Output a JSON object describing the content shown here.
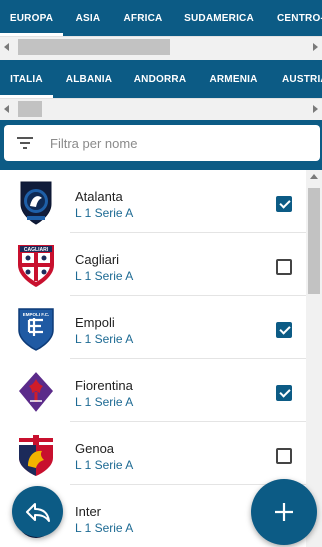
{
  "continent_tabs": [
    {
      "label": "EUROPA",
      "active": true
    },
    {
      "label": "ASIA"
    },
    {
      "label": "AFRICA"
    },
    {
      "label": "SUDAMERICA"
    },
    {
      "label": "CENTRO-NORD AMERICA"
    }
  ],
  "country_tabs": [
    {
      "label": "ITALIA",
      "active": true
    },
    {
      "label": "ALBANIA"
    },
    {
      "label": "ANDORRA"
    },
    {
      "label": "ARMENIA"
    },
    {
      "label": "AUSTRIA"
    }
  ],
  "filter": {
    "placeholder": "Filtra per nome",
    "value": ""
  },
  "teams": [
    {
      "name": "Atalanta",
      "league": "L 1 Serie A",
      "checked": true,
      "crest_icon": "atalanta-crest-icon"
    },
    {
      "name": "Cagliari",
      "league": "L 1 Serie A",
      "checked": false,
      "crest_icon": "cagliari-crest-icon"
    },
    {
      "name": "Empoli",
      "league": "L 1 Serie A",
      "checked": true,
      "crest_icon": "empoli-crest-icon"
    },
    {
      "name": "Fiorentina",
      "league": "L 1 Serie A",
      "checked": true,
      "crest_icon": "fiorentina-crest-icon"
    },
    {
      "name": "Genoa",
      "league": "L 1 Serie A",
      "checked": false,
      "crest_icon": "genoa-crest-icon"
    },
    {
      "name": "Inter",
      "league": "L 1 Serie A",
      "checked": false,
      "crest_icon": "inter-crest-icon"
    }
  ],
  "crest_text": {
    "cagliari": "CAGLIARI",
    "empoli": "EMPOLI F.C."
  },
  "fabs": {
    "back_icon": "reply-arrow-icon",
    "add_icon": "plus-icon"
  },
  "colors": {
    "primary": "#0c5b85",
    "league_text": "#1d6a93"
  }
}
